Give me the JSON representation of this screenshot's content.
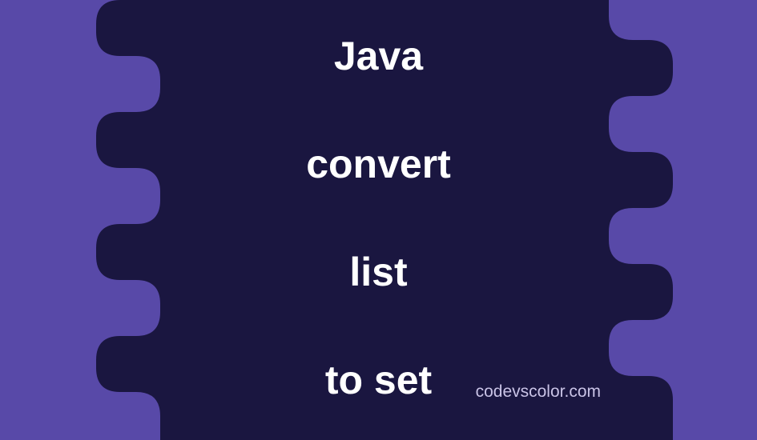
{
  "title": {
    "line1": "Java",
    "line2": "convert",
    "line3": "list",
    "line4": "to set"
  },
  "watermark": "codevscolor.com",
  "colors": {
    "background": "#5849a8",
    "blob": "#1a1640",
    "text": "#ffffff",
    "watermark": "#c9c3e6"
  }
}
